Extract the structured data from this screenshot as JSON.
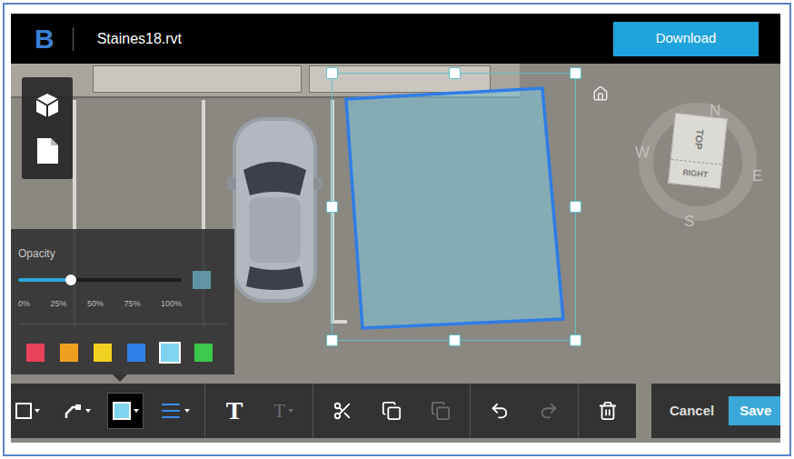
{
  "header": {
    "logo": "B",
    "filename": "Staines18.rvt",
    "download": "Download"
  },
  "compass": {
    "directions": [
      "N",
      "E",
      "S",
      "W"
    ],
    "top_face": "TOP",
    "side_face": "RIGHT"
  },
  "opacity_panel": {
    "title": "Opacity",
    "level": 0.32,
    "ticks": [
      "0%",
      "25%",
      "50%",
      "75%",
      "100%"
    ],
    "swatches": [
      {
        "color": "#e8415a",
        "selected": false
      },
      {
        "color": "#f0a020",
        "selected": false
      },
      {
        "color": "#f0d020",
        "selected": false
      },
      {
        "color": "#2f80e8",
        "selected": false
      },
      {
        "color": "#7fd3ee",
        "selected": true
      },
      {
        "color": "#3cc84a",
        "selected": false
      }
    ]
  },
  "toolbar": {
    "groups": [
      [
        {
          "kind": "shape",
          "selected": false,
          "disabled": false
        },
        {
          "kind": "arrow",
          "selected": false,
          "disabled": false
        },
        {
          "kind": "fill",
          "selected": true,
          "disabled": false
        },
        {
          "kind": "stroke",
          "selected": false,
          "disabled": false
        }
      ],
      [
        {
          "kind": "text",
          "label": "T",
          "selected": false,
          "disabled": false
        },
        {
          "kind": "text-size",
          "label": "T",
          "selected": false,
          "disabled": true
        }
      ],
      [
        {
          "kind": "cut",
          "selected": false,
          "disabled": false
        },
        {
          "kind": "copy",
          "selected": false,
          "disabled": false
        },
        {
          "kind": "paste",
          "selected": false,
          "disabled": true
        }
      ],
      [
        {
          "kind": "undo",
          "selected": false,
          "disabled": false
        },
        {
          "kind": "redo",
          "selected": false,
          "disabled": true
        }
      ],
      [
        {
          "kind": "delete",
          "selected": false,
          "disabled": false
        }
      ]
    ]
  },
  "actions": [
    {
      "label": "Cancel",
      "primary": false
    },
    {
      "label": "Save",
      "primary": true
    }
  ]
}
